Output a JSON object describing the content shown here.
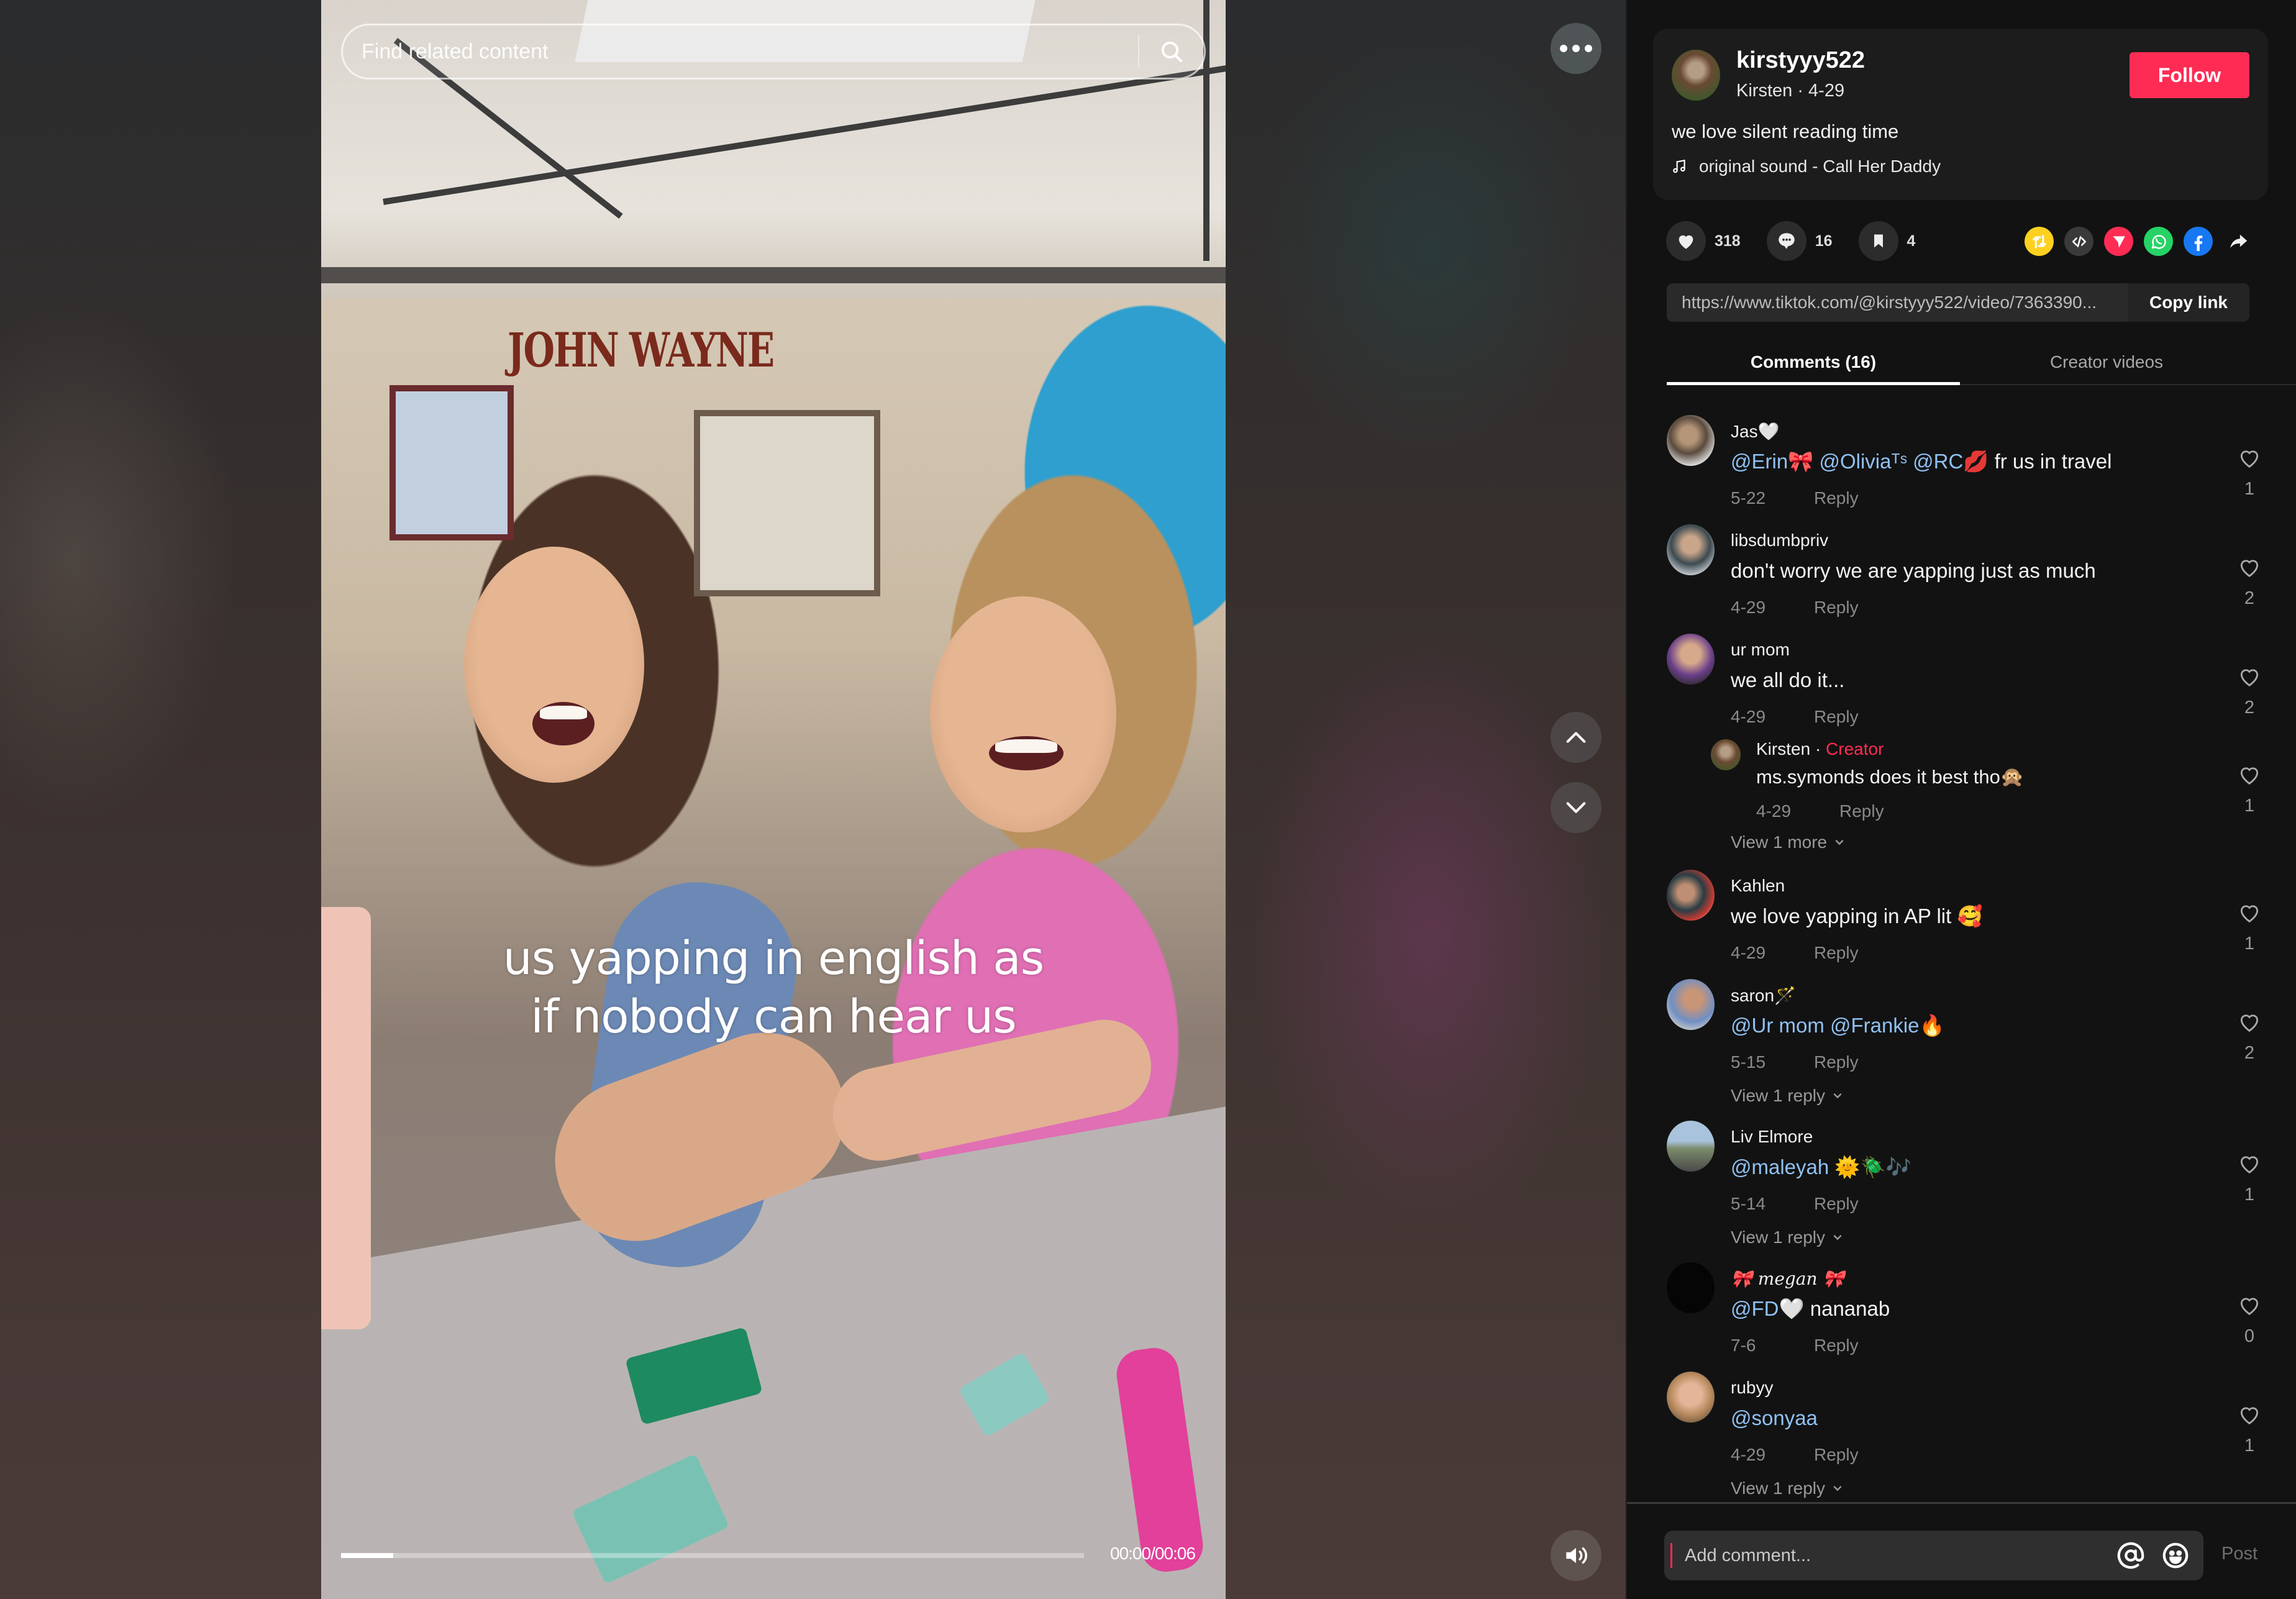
{
  "video": {
    "search_placeholder": "Find related content",
    "caption_line1": "us yapping in english as",
    "caption_line2": "if nobody can hear us",
    "scene_sign": "JOHN WAYNE",
    "progress_fraction": 0.07,
    "time_display": "00:00/00:06"
  },
  "post": {
    "username": "kirstyyy522",
    "display_name": "Kirsten",
    "date": "4-29",
    "meta": "Kirsten · 4-29",
    "follow_label": "Follow",
    "description": "we love silent reading time",
    "sound": "original sound - Call Her Daddy",
    "likes": "318",
    "comments": "16",
    "saves": "4",
    "link": "https://www.tiktok.com/@kirstyyy522/video/7363390...",
    "copy_label": "Copy link",
    "share_targets": [
      "repost",
      "embed",
      "send-to-friends",
      "whatsapp",
      "facebook",
      "share-more"
    ],
    "colors": {
      "accent": "#fe2c55",
      "repost": "#fcd11f",
      "embed": "#3a3a3a",
      "send": "#fe2c55",
      "whatsapp": "#25d366",
      "facebook": "#1877f2",
      "mention": "#8fc1f3"
    }
  },
  "tabs": [
    {
      "label": "Comments (16)",
      "active": true
    },
    {
      "label": "Creator videos",
      "active": false
    }
  ],
  "comments": [
    {
      "name": "Jas🤍",
      "mentions": [
        "@Erin🎀",
        "@Oliviaᵀˢ",
        "@RC💋"
      ],
      "text": "fr us in travel",
      "date": "5-22",
      "reply": "Reply",
      "likes": "1"
    },
    {
      "name": "libsdumbpriv",
      "mentions": [],
      "text": "don't worry we are yapping just as much",
      "date": "4-29",
      "reply": "Reply",
      "likes": "2"
    },
    {
      "name": "ur mom",
      "mentions": [],
      "text": "we all do it...",
      "date": "4-29",
      "reply": "Reply",
      "likes": "2",
      "replies": [
        {
          "name": "Kirsten",
          "badge": "Creator",
          "text": "ms.symonds does it best tho🙊",
          "date": "4-29",
          "reply": "Reply",
          "likes": "1"
        }
      ],
      "view_more": "View 1 more"
    },
    {
      "name": "Kahlen",
      "mentions": [],
      "text": "we love yapping in AP lit 🥰",
      "date": "4-29",
      "reply": "Reply",
      "likes": "1"
    },
    {
      "name": "saron🪄",
      "mentions": [
        "@Ur mom",
        "@Frankie🔥"
      ],
      "text": "",
      "date": "5-15",
      "reply": "Reply",
      "likes": "2",
      "view_more": "View 1 reply"
    },
    {
      "name": "Liv Elmore",
      "mentions": [
        "@maleyah"
      ],
      "text": "🌞🪲🎶",
      "date": "5-14",
      "reply": "Reply",
      "likes": "1",
      "view_more": "View 1 reply"
    },
    {
      "name": "🎀 megan 🎀",
      "mentions": [
        "@FD🤍"
      ],
      "text": "nananab",
      "date": "7-6",
      "reply": "Reply",
      "likes": "0"
    },
    {
      "name": "rubyy",
      "mentions": [
        "@sonyaa"
      ],
      "text": "",
      "date": "4-29",
      "reply": "Reply",
      "likes": "1",
      "view_more": "View 1 reply"
    }
  ],
  "composer": {
    "placeholder": "Add comment...",
    "post_label": "Post"
  },
  "icons": {
    "search": "search-icon",
    "more": "more-horizontal-icon",
    "up": "chevron-up-icon",
    "down": "chevron-down-icon",
    "volume": "volume-icon",
    "music": "music-note-icon",
    "like": "heart-icon",
    "comment": "comment-icon",
    "save": "bookmark-icon",
    "mention": "at-icon",
    "emoji": "emoji-icon"
  }
}
